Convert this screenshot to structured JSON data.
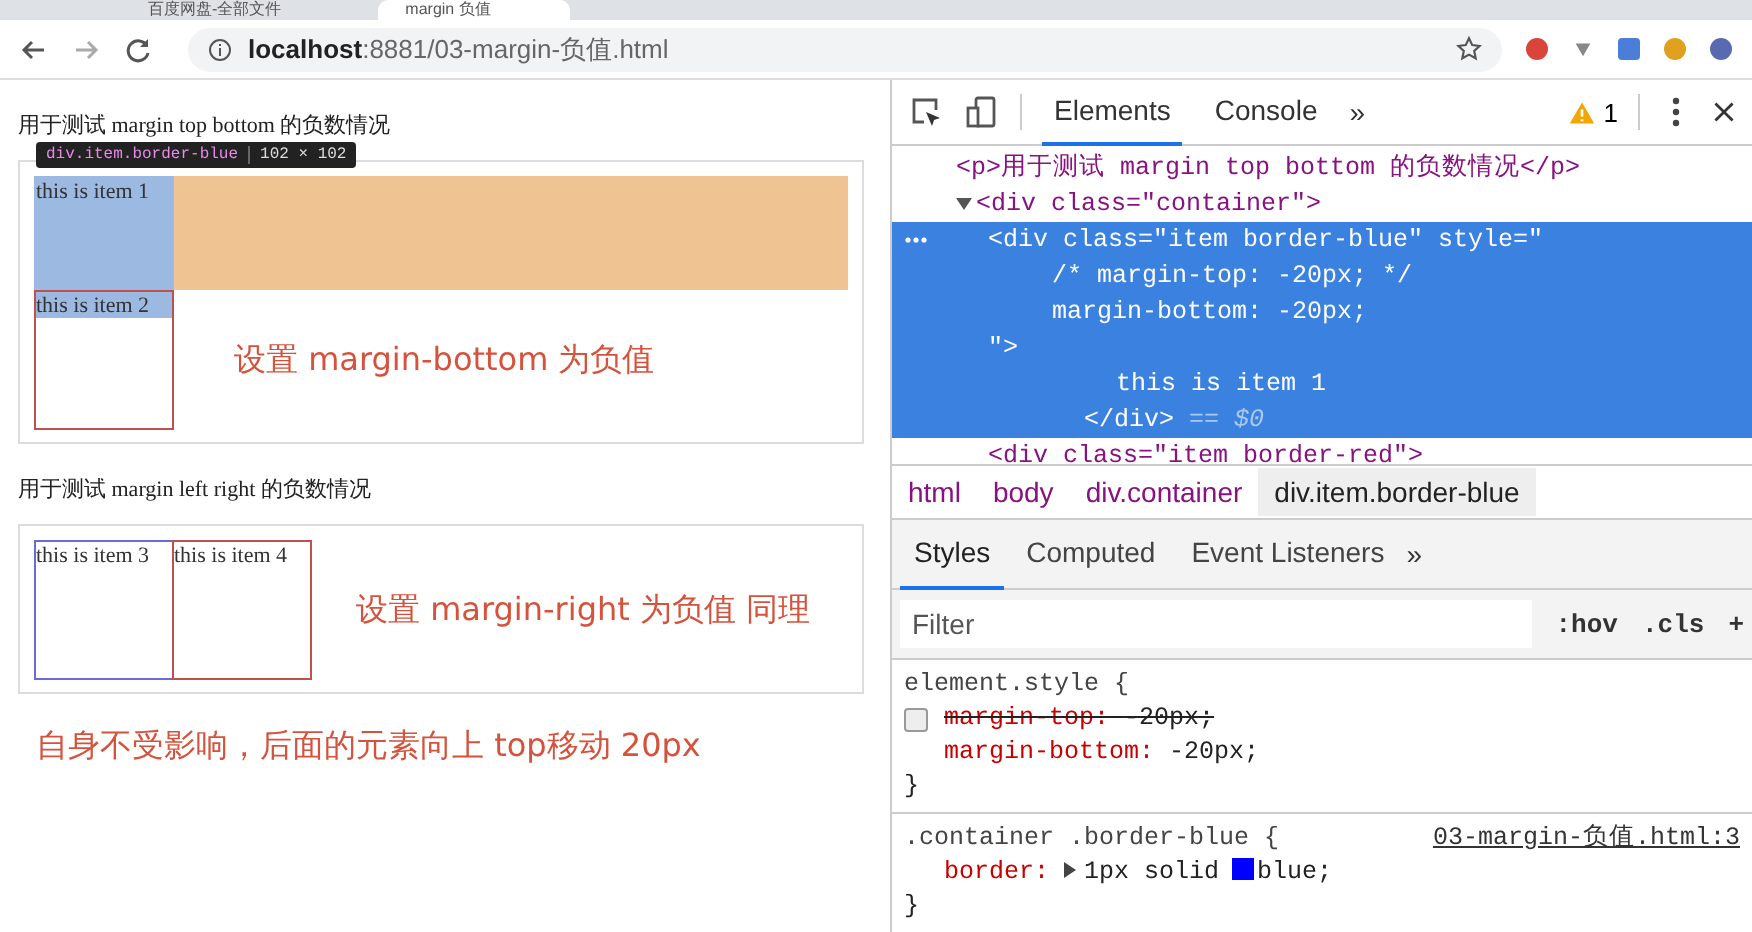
{
  "browser": {
    "tabs": [
      {
        "title": "百度网盘-全部文件",
        "selected": false
      },
      {
        "title": "margin 负值",
        "selected": true
      }
    ],
    "url": {
      "host": "localhost",
      "path": ":8881/03-margin-负值.html"
    }
  },
  "page": {
    "tooltip": {
      "selector": "div.item.border-blue",
      "size": "102 × 102"
    },
    "sections": [
      {
        "heading": "用于测试 margin top bottom 的负数情况",
        "kind": "vertical",
        "annotation": "设置 margin-bottom 为负值",
        "items": [
          {
            "text": "this is item 1",
            "highlighted": true
          },
          {
            "text": "this is item 2",
            "color": "#c0504d",
            "highlighted": false
          }
        ]
      },
      {
        "heading": "用于测试 margin left right 的负数情况",
        "kind": "horizontal",
        "annotation": "设置 margin-right 为负值 同理",
        "items": [
          {
            "text": "this is item 3",
            "color": "#6b6bd6",
            "highlighted": false
          },
          {
            "text": "this is item 4",
            "color": "#c0504d",
            "highlighted": false
          }
        ]
      }
    ],
    "note": "自身不受影响，后面的元素向上 top移动 20px"
  },
  "devtools": {
    "tabs": [
      {
        "label": "Elements",
        "selected": true
      },
      {
        "label": "Console",
        "selected": false
      }
    ],
    "more": "»",
    "warnings": "1",
    "dom": [
      {
        "tag": "<p>用于测试 margin top bottom 的负数情况</p>",
        "selected": false
      },
      {
        "tag": "<div class=\"container\">",
        "selected": false,
        "expanded": true,
        "children": [
          {
            "tag": "<div class=\"item border-blue\" style=\"",
            "lines": [
              "/* margin-top: -20px; */",
              "margin-bottom: -20px;",
              "\">",
              "this is item 1",
              "</div>"
            ],
            "suffix": "== $0",
            "selected": true
          },
          {
            "tag": "<div class=\"item border-red\">",
            "selected": false
          }
        ]
      }
    ],
    "breadcrumbs": [
      {
        "label": "html",
        "selected": false
      },
      {
        "label": "body",
        "selected": false
      },
      {
        "label": "div.container",
        "selected": false
      },
      {
        "label": "div.item.border-blue",
        "selected": true
      }
    ],
    "style_tabs": [
      {
        "label": "Styles",
        "selected": true
      },
      {
        "label": "Computed",
        "selected": false
      },
      {
        "label": "Event Listeners",
        "selected": false
      }
    ],
    "style_more": "»",
    "filter": {
      "placeholder": "Filter"
    },
    "filter_buttons": [
      ":hov",
      ".cls",
      "+"
    ],
    "rules": [
      {
        "selector": "element.style {",
        "declarations": [
          {
            "property": "margin-top:",
            "value": "-20px;",
            "checked": false
          },
          {
            "property": "margin-bottom:",
            "value": "-20px;",
            "checked": true
          }
        ],
        "close": "}"
      },
      {
        "selector": ".container .border-blue {",
        "source": "03-margin-负值.html:3",
        "declarations": [
          {
            "property": "border:",
            "value": "1px solid",
            "color": "#0000ff",
            "value_end": "blue;",
            "checked": true,
            "expandable": true
          }
        ],
        "close": "}"
      }
    ]
  }
}
